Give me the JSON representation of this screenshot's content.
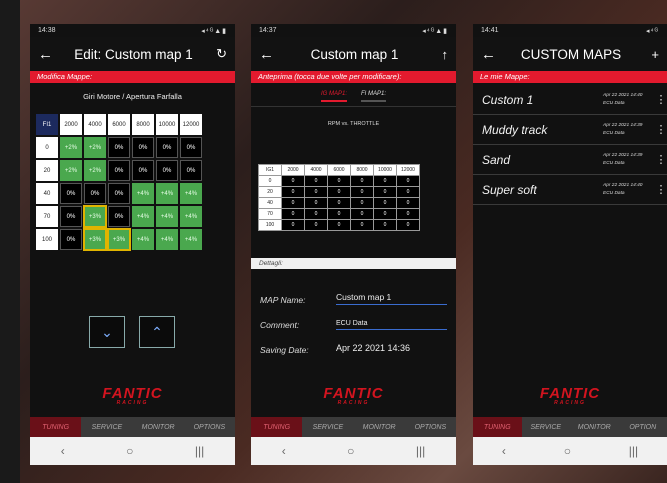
{
  "phone1": {
    "status": {
      "time": "14:38",
      "icons": "◂⁴ᴳ▲▮"
    },
    "appbar": {
      "back": "←",
      "title": "Edit: Custom map 1",
      "history": "↻"
    },
    "section_label": "Modifica Mappe:",
    "subtitle": "Giri Motore / Apertura Farfalla",
    "grid": {
      "corner": "FI1",
      "columns": [
        "2000",
        "4000",
        "6000",
        "8000",
        "10000",
        "12000"
      ],
      "rows": [
        {
          "label": "0",
          "cells": [
            {
              "v": "+2%",
              "t": "g"
            },
            {
              "v": "+2%",
              "t": "g"
            },
            {
              "v": "0%",
              "t": "b"
            },
            {
              "v": "0%",
              "t": "b"
            },
            {
              "v": "0%",
              "t": "b"
            },
            {
              "v": "0%",
              "t": "b"
            }
          ]
        },
        {
          "label": "20",
          "cells": [
            {
              "v": "+2%",
              "t": "g"
            },
            {
              "v": "+2%",
              "t": "g"
            },
            {
              "v": "0%",
              "t": "b"
            },
            {
              "v": "0%",
              "t": "b"
            },
            {
              "v": "0%",
              "t": "b"
            },
            {
              "v": "0%",
              "t": "b"
            }
          ]
        },
        {
          "label": "40",
          "cells": [
            {
              "v": "0%",
              "t": "b"
            },
            {
              "v": "0%",
              "t": "b"
            },
            {
              "v": "0%",
              "t": "b"
            },
            {
              "v": "+4%",
              "t": "g"
            },
            {
              "v": "+4%",
              "t": "g"
            },
            {
              "v": "+4%",
              "t": "g"
            }
          ]
        },
        {
          "label": "70",
          "cells": [
            {
              "v": "0%",
              "t": "b"
            },
            {
              "v": "+3%",
              "t": "gs"
            },
            {
              "v": "0%",
              "t": "b"
            },
            {
              "v": "+4%",
              "t": "g"
            },
            {
              "v": "+4%",
              "t": "g"
            },
            {
              "v": "+4%",
              "t": "g"
            }
          ]
        },
        {
          "label": "100",
          "cells": [
            {
              "v": "0%",
              "t": "b"
            },
            {
              "v": "+3%",
              "t": "gs"
            },
            {
              "v": "+3%",
              "t": "gs"
            },
            {
              "v": "+4%",
              "t": "g"
            },
            {
              "v": "+4%",
              "t": "g"
            },
            {
              "v": "+4%",
              "t": "g"
            }
          ]
        }
      ]
    },
    "down_button": "⌄",
    "up_button": "⌃",
    "logo": "FANTIC",
    "logo_sub": "RACING",
    "tabs": [
      "TUNING",
      "SERVICE",
      "MONITOR",
      "OPTIONS"
    ],
    "active_tab": "TUNING",
    "sysnav": [
      "‹",
      "○",
      "|||"
    ]
  },
  "phone2": {
    "status": {
      "time": "14:37",
      "icons": "◂⁴ᴳ▲▮"
    },
    "appbar": {
      "back": "←",
      "title": "Custom map 1",
      "action": "↑"
    },
    "section_label": "Anteprima (tocca due volte per modificare):",
    "preview_tabs": [
      "IG MAP1:",
      "FI MAP1:"
    ],
    "chart_title": "RPM vs. THROTTLE",
    "table": {
      "corner": "IG1",
      "columns": [
        "2000",
        "4000",
        "6000",
        "8000",
        "10000",
        "12000"
      ],
      "rows": [
        {
          "label": "0",
          "cells": [
            "0",
            "0",
            "0",
            "0",
            "0",
            "0"
          ]
        },
        {
          "label": "20",
          "cells": [
            "0",
            "0",
            "0",
            "0",
            "0",
            "0"
          ]
        },
        {
          "label": "40",
          "cells": [
            "0",
            "0",
            "0",
            "0",
            "0",
            "0"
          ]
        },
        {
          "label": "70",
          "cells": [
            "0",
            "0",
            "0",
            "0",
            "0",
            "0"
          ]
        },
        {
          "label": "100",
          "cells": [
            "0",
            "0",
            "0",
            "0",
            "0",
            "0"
          ]
        }
      ]
    },
    "details_label": "Dettagli:",
    "form": {
      "map_name_label": "MAP Name:",
      "map_name_value": "Custom map 1",
      "comment_label": "Comment:",
      "comment_value": "ECU Data",
      "saving_date_label": "Saving Date:",
      "saving_date_value": "Apr 22 2021 14:36"
    },
    "logo": "FANTIC",
    "logo_sub": "RACING",
    "tabs": [
      "TUNING",
      "SERVICE",
      "MONITOR",
      "OPTIONS"
    ],
    "active_tab": "TUNING",
    "sysnav": [
      "‹",
      "○",
      "|||"
    ]
  },
  "phone3": {
    "status": {
      "time": "14:41",
      "icons": "◂⁴ᴳ"
    },
    "appbar": {
      "back": "←",
      "title": "CUSTOM MAPS",
      "add": "+"
    },
    "section_label": "Le mie Mappe:",
    "maps": [
      {
        "name": "Custom 1",
        "date": "Apr 22 2021 14:40",
        "source": "ECU Data"
      },
      {
        "name": "Muddy track",
        "date": "Apr 22 2021 14:39",
        "source": "ECU Data"
      },
      {
        "name": "Sand",
        "date": "Apr 22 2021 14:39",
        "source": "ECU Data"
      },
      {
        "name": "Super soft",
        "date": "Apr 22 2021 14:40",
        "source": "ECU Data"
      }
    ],
    "logo": "FANTIC",
    "logo_sub": "RACING",
    "tabs": [
      "TUNING",
      "SERVICE",
      "MONITOR",
      "OPTION"
    ],
    "active_tab": "TUNING",
    "sysnav": [
      "‹",
      "○",
      "|||"
    ]
  }
}
